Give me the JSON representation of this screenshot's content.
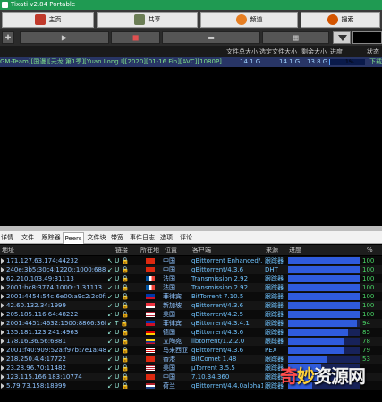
{
  "app": {
    "title": "Tixati v2.84 Portable"
  },
  "toolbar": {
    "home": "主页",
    "share": "共享",
    "channels": "频道",
    "search": "搜索"
  },
  "downloads": {
    "columns": [
      "文件总大小",
      "选定文件大小",
      "剩余大小",
      "进度",
      "状态"
    ],
    "rows": [
      {
        "name": "GM-Team][国漫][元龙 第1季][Yuan Long Ⅰ][2020][01-16 Fin][AVC][1080P]",
        "total_size": "14.1 G",
        "selected_size": "14.1 G",
        "remaining": "13.8 G",
        "progress_label": "1%",
        "progress_value": 0.01,
        "status": "下载"
      }
    ]
  },
  "tabs": [
    "详情",
    "文件",
    "跟踪器",
    "Peers",
    "文件块",
    "带宽",
    "事件日志",
    "选项",
    "评论"
  ],
  "active_tab": "Peers",
  "peers": {
    "columns": {
      "address": "地址",
      "connection": "链接",
      "located": "所在地",
      "location": "位置",
      "client": "客户端",
      "source": "来源",
      "progress": "进度",
      "percent": "%"
    },
    "rows": [
      {
        "address": "171.127.63.174:44232",
        "conn": "↖ U 🔒",
        "flag": "cn",
        "location": "中国",
        "client": "qBittorrent Enhanced/...",
        "source": "跟踪器",
        "pct": "100",
        "progress": 1.0
      },
      {
        "address": "240e:3b5:30c4:1220::1000:6882",
        "conn": "↙ U 🔒",
        "flag": "cn",
        "location": "中国",
        "client": "qBittorrent/4.3.6",
        "source": "DHT",
        "pct": "100",
        "progress": 1.0
      },
      {
        "address": "62.210.103.49:31113",
        "conn": "↙ U 🔒",
        "flag": "fr",
        "location": "法国",
        "client": "Transmission 2.92",
        "source": "跟踪器",
        "pct": "100",
        "progress": 1.0
      },
      {
        "address": "2001:bc8:3774:1000::1:31113",
        "conn": "↙ U 🔒",
        "flag": "fr",
        "location": "法国",
        "client": "Transmission 2.92",
        "source": "跟踪器",
        "pct": "100",
        "progress": 1.0
      },
      {
        "address": "2001:4454:54c:6e00:a9c2:2c0f:2...",
        "conn": "↙ U 🔒",
        "flag": "ph",
        "location": "菲律宾",
        "client": "BitTorrent 7.10.5",
        "source": "跟踪器",
        "pct": "100",
        "progress": 1.0
      },
      {
        "address": "42.60.132.34:1999",
        "conn": "↙ U 🔒",
        "flag": "sg",
        "location": "新加坡",
        "client": "qBittorrent/4.3.6",
        "source": "跟踪器",
        "pct": "100",
        "progress": 1.0
      },
      {
        "address": "205.185.116.64:48222",
        "conn": "↙ U 🔒",
        "flag": "us",
        "location": "美国",
        "client": "qBittorrent/4.2.5",
        "source": "跟踪器",
        "pct": "100",
        "progress": 1.0
      },
      {
        "address": "2001:4451:4632:1500:8866:36f8:...",
        "conn": "↙ T 🔒",
        "flag": "ph",
        "location": "菲律宾",
        "client": "qBittorrent/4.3.4.1",
        "source": "跟踪器",
        "pct": "94",
        "progress": 0.94
      },
      {
        "address": "135.181.123.241:4963",
        "conn": "↙ U 🔒",
        "flag": "de",
        "location": "德国",
        "client": "qBittorrent/4.3.6",
        "source": "跟踪器",
        "pct": "85",
        "progress": 0.85
      },
      {
        "address": "178.16.36.56:6881",
        "conn": "↙ U 🔒",
        "flag": "co",
        "location": "立陶宛",
        "client": "libtorrent/1.2.2.0",
        "source": "跟踪器",
        "pct": "78",
        "progress": 0.78
      },
      {
        "address": "2001:f40:909:52a:f97b:7e1a:485...",
        "conn": "↙ U 🔒",
        "flag": "my",
        "location": "马来西亚",
        "client": "qBittorrent/4.3.6",
        "source": "PEX",
        "pct": "79",
        "progress": 0.79
      },
      {
        "address": "218.250.4.4:17722",
        "conn": "↙ U 🔒",
        "flag": "hk",
        "location": "香港",
        "client": "BitComet 1.48",
        "source": "跟踪器",
        "pct": "53",
        "progress": 0.53
      },
      {
        "address": "23.28.96.70:11482",
        "conn": "↙ U 🔒",
        "flag": "us",
        "location": "美国",
        "client": "µTorrent 3.5.5",
        "source": "跟踪器",
        "pct": "",
        "progress": 0.45
      },
      {
        "address": "123.115.166.183:10774",
        "conn": "↙ U 🔒",
        "flag": "cn",
        "location": "中国",
        "client": "7.10.34.360",
        "source": "跟踪器",
        "pct": "",
        "progress": 0.4
      },
      {
        "address": "5.79.73.158:18999",
        "conn": "↙ U 🔒",
        "flag": "nl",
        "location": "荷兰",
        "client": "qBittorrent/4.4.0alpha1",
        "source": "跟踪器",
        "pct": "",
        "progress": 0.35
      }
    ]
  },
  "watermark": {
    "part1": "奇",
    "part2": "妙",
    "part3": "资源网"
  },
  "colors": {
    "titlebar": "#1f9a52",
    "selected_row": "#283565",
    "progress_full": "#2f5bdc",
    "percent_text": "#49d766"
  }
}
